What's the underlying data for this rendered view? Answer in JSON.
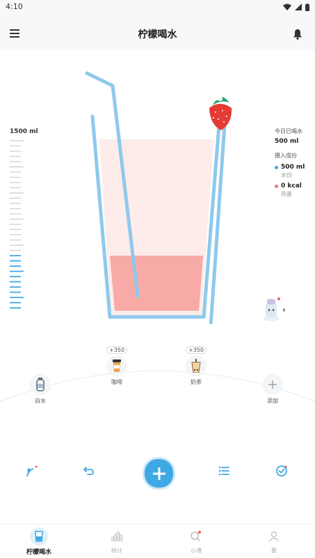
{
  "status": {
    "time": "4:10"
  },
  "header": {
    "title": "柠檬喝水"
  },
  "scale": {
    "max_label": "1500 ml",
    "fill_fraction": 0.33
  },
  "info": {
    "today_label": "今日已喝水",
    "today_value": "500 ml",
    "intake_label": "摄入成份",
    "water_value": "500 ml",
    "water_label": "水份",
    "kcal_value": "0 kcal",
    "kcal_label": "热量",
    "water_color": "#3fa9e5",
    "kcal_color": "#f07575"
  },
  "drinks": [
    {
      "label": "白水",
      "icon": "water-bottle-icon",
      "plus": ""
    },
    {
      "label": "咖啡",
      "icon": "coffee-cup-icon",
      "plus": "+350"
    },
    {
      "label": "奶茶",
      "icon": "milk-tea-icon",
      "plus": "+350"
    },
    {
      "label": "添加",
      "icon": "plus-icon",
      "plus": ""
    }
  ],
  "fab": {
    "icon": "plus-icon"
  },
  "tabs": [
    {
      "label": "柠檬喝水",
      "icon": "cup-icon"
    },
    {
      "label": "统计",
      "icon": "bar-chart-icon"
    },
    {
      "label": "小通",
      "icon": "search-icon"
    },
    {
      "label": "我",
      "icon": "user-icon"
    }
  ],
  "colors": {
    "accent": "#3fa9e5",
    "glass": "#8ec9ec",
    "liquid": "#f8aaa6",
    "glass_bg": "#fdecea"
  }
}
